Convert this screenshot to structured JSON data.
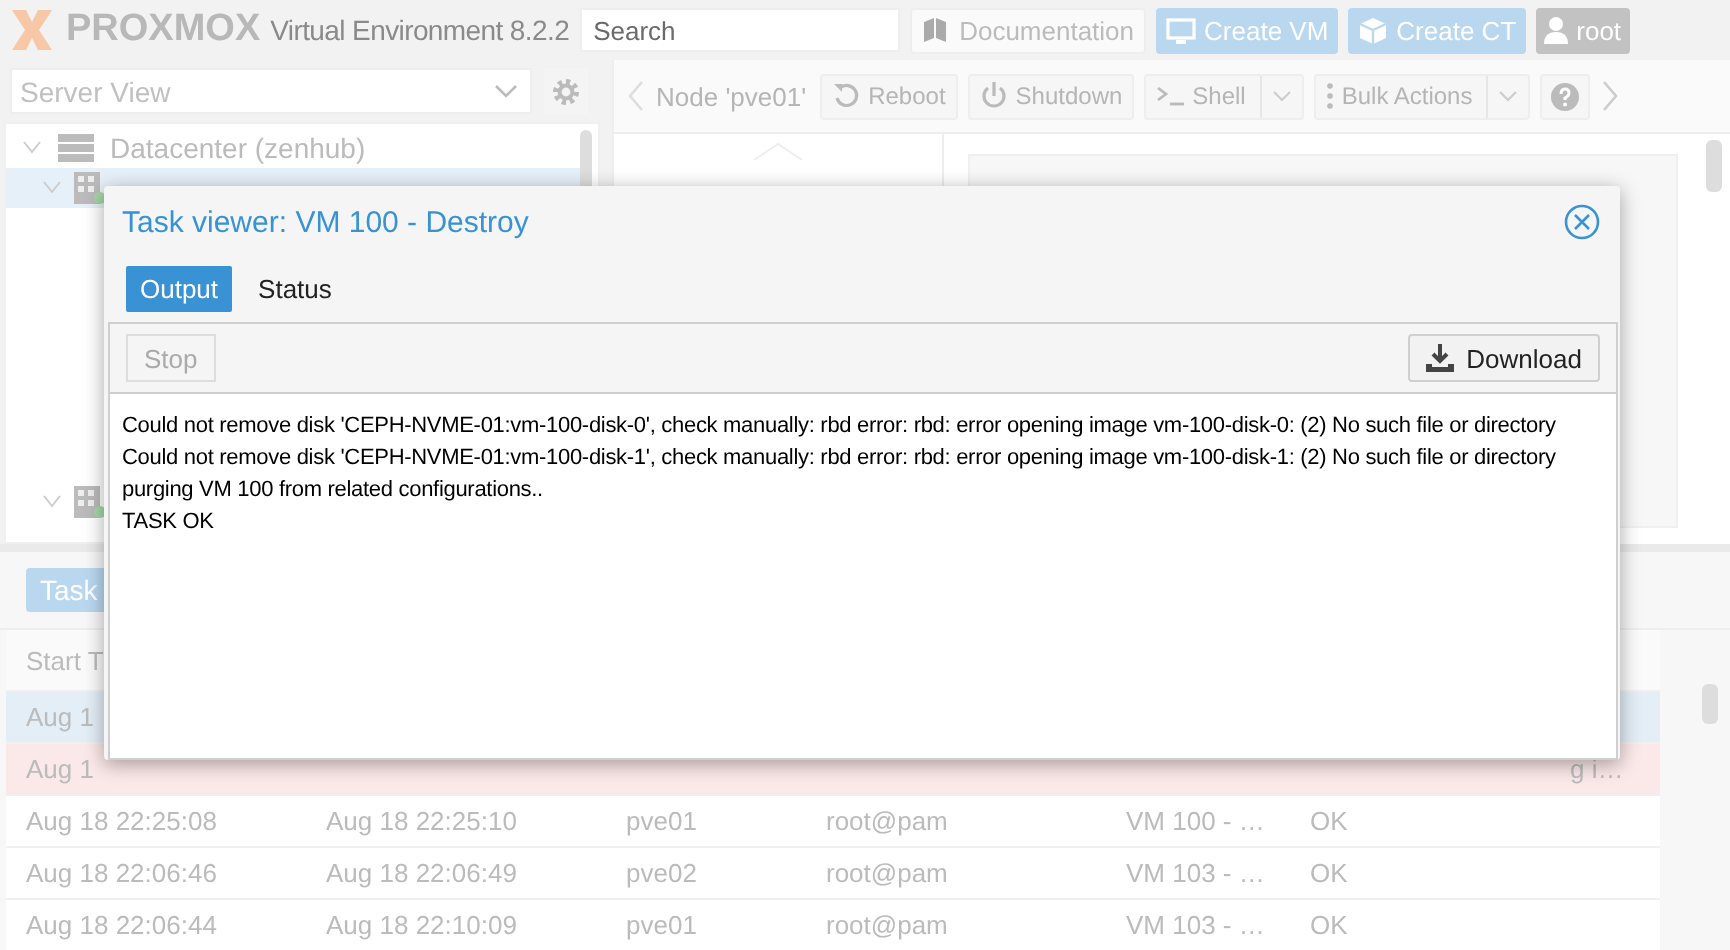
{
  "header": {
    "logo": "PROXMOX",
    "product": "Virtual Environment 8.2.2",
    "search": {
      "placeholder": "Search"
    },
    "buttons": [
      {
        "label": "Documentation",
        "kind": "plain"
      },
      {
        "label": "Create VM",
        "kind": "primary"
      },
      {
        "label": "Create CT",
        "kind": "primary"
      }
    ],
    "user": "root"
  },
  "sidebar": {
    "view": "Server View",
    "tree": [
      {
        "label": "Datacenter (zenhub)",
        "expanded": true,
        "children": [
          {
            "kind": "node",
            "selected": true,
            "expanded": true
          },
          {
            "kind": "node",
            "selected": false,
            "expanded": true
          }
        ]
      }
    ]
  },
  "node_toolbar": {
    "title": "Node 'pve01'",
    "buttons": [
      {
        "label": "Reboot",
        "kind": "reboot"
      },
      {
        "label": "Shutdown",
        "kind": "power"
      },
      {
        "label": "Shell",
        "kind": "shell"
      },
      {
        "label": "Bulk Actions",
        "kind": "bulk"
      }
    ]
  },
  "tasks": {
    "tab": "Task",
    "columns": [
      "Start T"
    ],
    "rows": [
      {
        "selected": true,
        "error": false,
        "cells": [
          "Aug 1",
          null,
          null,
          null,
          null,
          null,
          null
        ]
      },
      {
        "selected": false,
        "error": true,
        "cells": [
          "Aug 1",
          null,
          null,
          null,
          null,
          null,
          "g i…"
        ]
      },
      {
        "selected": false,
        "error": false,
        "cells": [
          "Aug 18 22:25:08",
          "Aug 18 22:25:10",
          "pve01",
          "root@pam",
          "VM 100 - …",
          "OK",
          null
        ]
      },
      {
        "selected": false,
        "error": false,
        "cells": [
          "Aug 18 22:06:46",
          "Aug 18 22:06:49",
          "pve02",
          "root@pam",
          "VM 103 - …",
          "OK",
          null
        ]
      },
      {
        "selected": false,
        "error": false,
        "cells": [
          "Aug 18 22:06:44",
          "Aug 18 22:10:09",
          "pve01",
          "root@pam",
          "VM 103 - …",
          "OK",
          null
        ]
      }
    ]
  },
  "dialog": {
    "title": "Task viewer: VM 100 - Destroy",
    "tabs": [
      {
        "label": "Output",
        "selected": true
      },
      {
        "label": "Status",
        "selected": false
      }
    ],
    "stop": {
      "label": "Stop",
      "disabled": true
    },
    "download": "Download",
    "output": [
      "Could not remove disk 'CEPH-NVME-01:vm-100-disk-0', check manually: rbd error: rbd: error opening image vm-100-disk-0: (2) No such file or directory",
      "Could not remove disk 'CEPH-NVME-01:vm-100-disk-1', check manually: rbd error: rbd: error opening image vm-100-disk-1: (2) No such file or directory",
      "purging VM 100 from related configurations..",
      "TASK OK"
    ]
  }
}
